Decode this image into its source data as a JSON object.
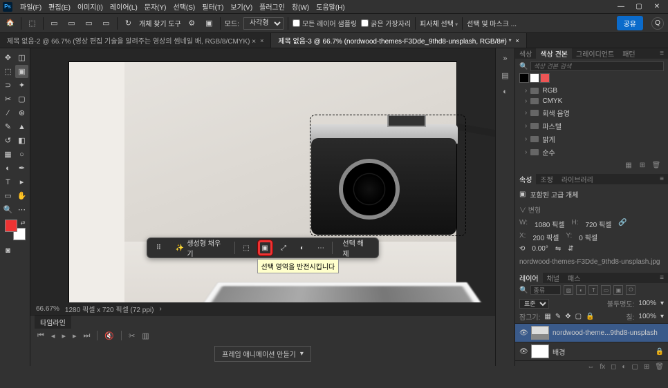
{
  "menu": {
    "items": [
      "파일(F)",
      "편집(E)",
      "이미지(I)",
      "레이어(L)",
      "문자(Y)",
      "선택(S)",
      "필터(T)",
      "보기(V)",
      "플러그인",
      "창(W)",
      "도움말(H)"
    ]
  },
  "window_controls": {
    "min": "—",
    "max": "▢",
    "close": "✕"
  },
  "options_bar": {
    "tool_label": "개체 찾기 도구",
    "mode_label": "모드:",
    "mode_value": "사각형",
    "sample_all": "모든 레이어 샘플링",
    "hard_edge": "굵은 가장자리",
    "subject_select": "피사체 선택",
    "select_mask": "선택 및 마스크 ...",
    "share": "공유"
  },
  "doc_tabs": [
    {
      "title": "제목 없음-2 @ 66.7% (영상 편집 기술을 알려주는 영상의 썸네일 배, RGB/8/CMYK) ×",
      "active": false
    },
    {
      "title": "제목 없음-3 @ 66.7% (nordwood-themes-F3Dde_9thd8-unsplash, RGB/8#) *",
      "active": true
    }
  ],
  "context_bar": {
    "gen_fill": "생성형 채우기",
    "deselect": "선택 해제",
    "tooltip": "선택 영역을 반전시킵니다"
  },
  "status": {
    "zoom": "66.67%",
    "dims": "1280 픽셀 x 720 픽셀 (72 ppi)"
  },
  "timeline": {
    "tab": "타임라인",
    "create_btn": "프레임 애니메이션 만들기"
  },
  "swatches_panel": {
    "tabs": [
      "색상",
      "색상 견본",
      "그레이디언트",
      "패턴"
    ],
    "active_tab": 1,
    "search_placeholder": "색상 견본 검색",
    "folders": [
      "RGB",
      "CMYK",
      "회색 음영",
      "파스텔",
      "밝게",
      "순수"
    ]
  },
  "properties_panel": {
    "tabs": [
      "속성",
      "조정",
      "라이브러리"
    ],
    "active_tab": 0,
    "obj_type": "포함된 고급 개체",
    "transform_header": "변형",
    "w_label": "W:",
    "w_val": "1080 픽셀",
    "h_label": "H:",
    "h_val": "720 픽셀",
    "x_label": "X:",
    "x_val": "200 픽셀",
    "y_label": "Y:",
    "y_val": "0 픽셀",
    "angle": "0.00°",
    "filename": "nordwood-themes-F3Dde_9thd8-unsplash.jpg"
  },
  "layers_panel": {
    "tabs": [
      "레이어",
      "채널",
      "패스"
    ],
    "active_tab": 0,
    "kind_label": "종류",
    "blend_mode": "표준",
    "opacity_label": "불투명도:",
    "opacity_val": "100%",
    "lock_label": "잠그기:",
    "fill_label": "칠:",
    "fill_val": "100%",
    "layers": [
      {
        "name": "nordwood-theme...9thd8-unsplash",
        "selected": true
      },
      {
        "name": "배경",
        "selected": false
      }
    ]
  }
}
